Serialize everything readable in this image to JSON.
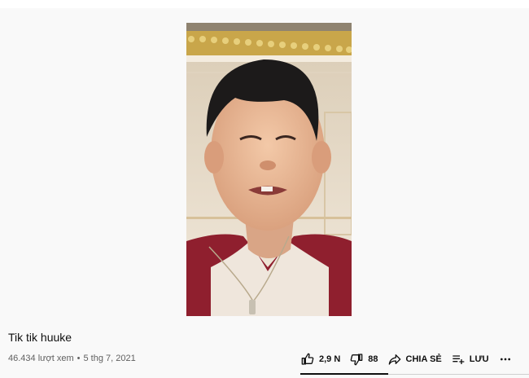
{
  "video": {
    "title": "Tik tik huuke",
    "views": "46.434 lượt xem",
    "separator": "•",
    "date": "5 thg 7, 2021"
  },
  "actions": {
    "like_count": "2,9 N",
    "dislike_count": "88",
    "share_label": "CHIA SẺ",
    "save_label": "LƯU",
    "more_icon": "more-horizontal-icon"
  },
  "colors": {
    "background": "#f9f9f9",
    "text_primary": "#0f0f0f",
    "text_secondary": "#606060"
  }
}
